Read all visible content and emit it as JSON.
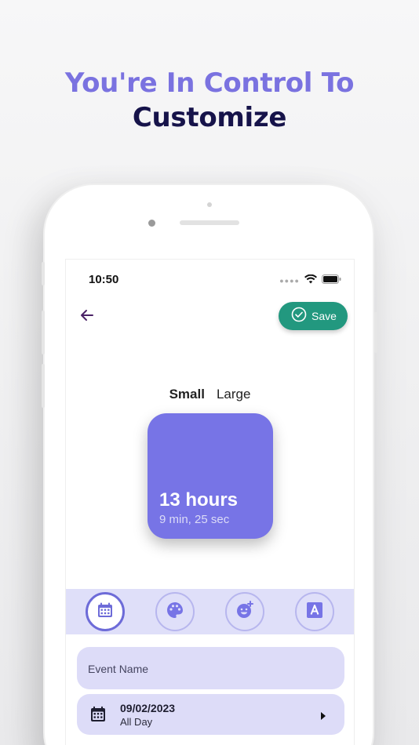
{
  "headline": {
    "line1": "You're In Control To",
    "line2": "Customize"
  },
  "status_bar": {
    "time": "10:50",
    "icons": [
      "signal-icon",
      "wifi-icon",
      "battery-icon"
    ]
  },
  "header": {
    "back_icon": "arrow-left-icon",
    "save_label": "Save",
    "save_icon": "check-circle-icon"
  },
  "size_options": {
    "small": "Small",
    "large": "Large",
    "selected": "Small"
  },
  "widget": {
    "main_text": "13 hours",
    "sub_text": "9 min, 25 sec"
  },
  "toolbar": {
    "tools": [
      "calendar-icon",
      "palette-icon",
      "emoji-icon",
      "text-format-icon"
    ],
    "active": "calendar-icon"
  },
  "form": {
    "event_name_placeholder": "Event Name",
    "date": "09/02/2023",
    "date_detail": "All Day"
  },
  "colors": {
    "accent_purple": "#7774e6",
    "headline_purple": "#7a72e0",
    "headline_dark": "#16134a",
    "save_green": "#22987f",
    "field_bg": "#dddcf8",
    "toolbar_bg": "#dfdff9"
  }
}
